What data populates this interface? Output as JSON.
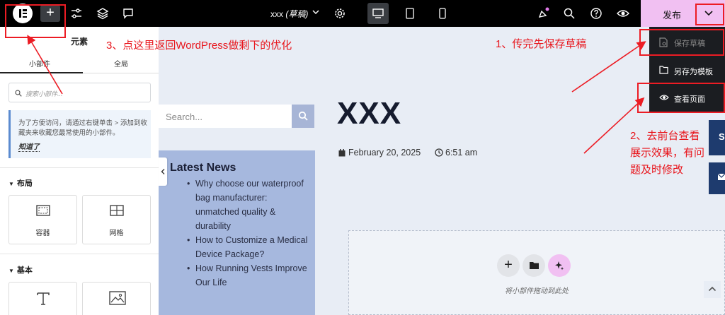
{
  "topbar": {
    "add_label": "+",
    "title_name": "xxx",
    "title_status": "(草稿)",
    "publish_label": "发布",
    "icons": [
      "elementor-logo-icon",
      "add-icon",
      "settings-sliders-icon",
      "layers-icon",
      "comments-icon",
      "chevron-down-icon",
      "gear-icon",
      "desktop-icon",
      "tablet-icon",
      "mobile-icon",
      "whats-new-icon",
      "search-icon",
      "help-icon",
      "preview-eye-icon",
      "chevron-down-icon"
    ],
    "accent_color": "#f1c0f2"
  },
  "sidebar": {
    "title": "元素",
    "tabs": [
      "小部件",
      "全局"
    ],
    "search_placeholder": "搜索小部件...",
    "info_text": "为了方便访问，请通过右键单击 > 添加到收藏夹来收藏您最常使用的小部件。",
    "info_link": "知道了",
    "sections": [
      {
        "title": "布局",
        "widgets": [
          {
            "label": "容器",
            "icon": "container-icon"
          },
          {
            "label": "网格",
            "icon": "grid-icon"
          }
        ]
      },
      {
        "title": "基本",
        "widgets": [
          {
            "label": "",
            "icon": "heading-text-icon"
          },
          {
            "label": "",
            "icon": "image-icon"
          }
        ]
      }
    ]
  },
  "canvas": {
    "search_placeholder": "Search...",
    "news_title": "Latest News",
    "news_items": [
      "Why choose our waterproof bag manufacturer: unmatched quality & durability",
      "How to Customize a Medical Device Package?",
      "How Running Vests Improve Our Life"
    ],
    "post_title": "XXX",
    "post_date": "February 20, 2025",
    "post_time": "6:51 am",
    "drop_text": "将小部件拖动到此处",
    "background_color": "#e8edf5"
  },
  "dropdown": {
    "items": [
      {
        "label": "保存草稿",
        "icon": "save-draft-icon",
        "disabled": true
      },
      {
        "label": "另存为模板",
        "icon": "folder-icon",
        "disabled": false
      },
      {
        "label": "查看页面",
        "icon": "eye-icon",
        "disabled": false
      }
    ]
  },
  "annotations": {
    "note1": "1、传完先保存草稿",
    "note2_line1": "2、去前台查看",
    "note2_line2": "展示效果，有问",
    "note2_line3": "题及时修改",
    "note3": "3、点这里返回WordPress做剩下的优化",
    "color": "#ec1c24"
  }
}
